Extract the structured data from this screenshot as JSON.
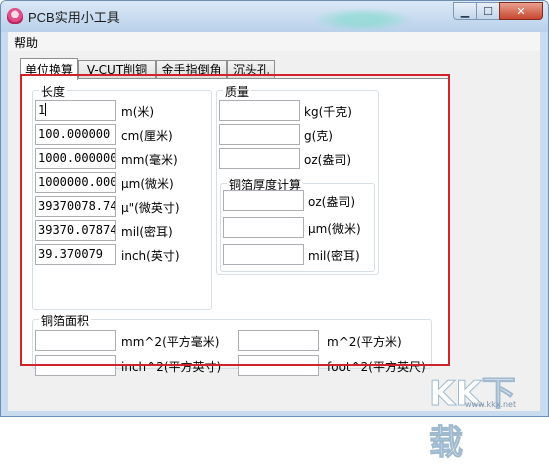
{
  "window": {
    "title": "PCB实用小工具"
  },
  "menu": {
    "help": "帮助"
  },
  "tabs": [
    "单位换算",
    "V-CUT削铜",
    "金手指倒角",
    "沉头孔"
  ],
  "length_group": {
    "title": "长度",
    "rows": [
      {
        "value": "1",
        "unit": "m(米)"
      },
      {
        "value": "100.000000",
        "unit": "cm(厘米)"
      },
      {
        "value": "1000.000000",
        "unit": "mm(毫米)"
      },
      {
        "value": "1000000.000",
        "unit": "μm(微米)"
      },
      {
        "value": "39370078.74",
        "unit": "μ\"(微英寸)"
      },
      {
        "value": "39370.07874",
        "unit": "mil(密耳)"
      },
      {
        "value": "39.370079",
        "unit": "inch(英寸)"
      }
    ]
  },
  "mass_group": {
    "title": "质量",
    "rows": [
      {
        "value": "",
        "unit": "kg(千克)"
      },
      {
        "value": "",
        "unit": "g(克)"
      },
      {
        "value": "",
        "unit": "oz(盎司)"
      }
    ]
  },
  "copper_thickness_group": {
    "title": "铜箔厚度计算",
    "rows": [
      {
        "value": "",
        "unit": "oz(盎司)"
      },
      {
        "value": "",
        "unit": "μm(微米)"
      },
      {
        "value": "",
        "unit": "mil(密耳)"
      }
    ]
  },
  "copper_area_group": {
    "title": "铜箔面积",
    "rows": [
      {
        "value": "",
        "unit": "mm^2(平方毫米)"
      },
      {
        "value": "",
        "unit": "m^2(平方米)"
      },
      {
        "value": "",
        "unit": "inch^2(平方英寸)"
      },
      {
        "value": "",
        "unit": "foot^2(平方英尺)"
      }
    ]
  },
  "watermark": {
    "text": "KK下载",
    "sub": "www.kkx.net"
  },
  "colors": {
    "highlight_border": "#d2232a",
    "titlebar": "#c9dcef",
    "close_button": "#c8472f"
  }
}
